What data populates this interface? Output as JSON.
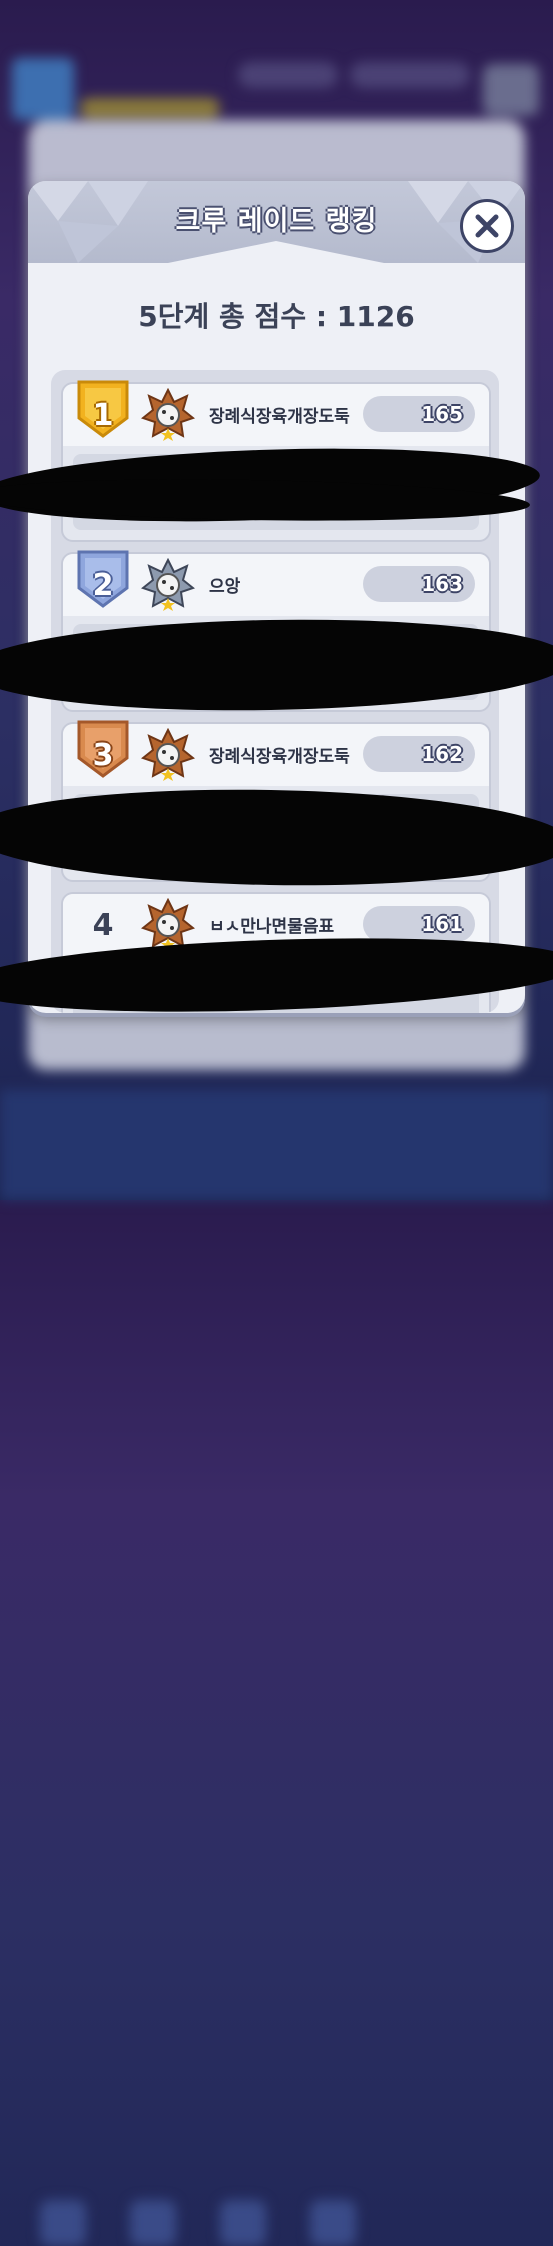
{
  "modal": {
    "title": "크루 레이드 랭킹",
    "close_icon": "close-x-icon"
  },
  "score": {
    "label": "5단계 총 점수 : 1126"
  },
  "ranking": [
    {
      "rank": "1",
      "name": "장례식장육개장도둑",
      "score": "165",
      "badge_color": "#f2b21f",
      "crest": "bronze-crest-icon"
    },
    {
      "rank": "2",
      "name": "으앙",
      "score": "163",
      "badge_color": "#8fa6dd",
      "crest": "silver-crest-icon"
    },
    {
      "rank": "3",
      "name": "장례식장육개장도둑",
      "score": "162",
      "badge_color": "#d98a4e",
      "crest": "bronze-crest-icon"
    },
    {
      "rank": "4",
      "name": "ㅂㅅ만나면물음표",
      "score": "161",
      "badge_color": "",
      "crest": "bronze-crest-icon"
    }
  ],
  "colors": {
    "panel": "#eef0f6",
    "outline": "#3d4466",
    "gold": "#f2b21f",
    "silver": "#8fa6dd",
    "bronze": "#d98a4e"
  }
}
